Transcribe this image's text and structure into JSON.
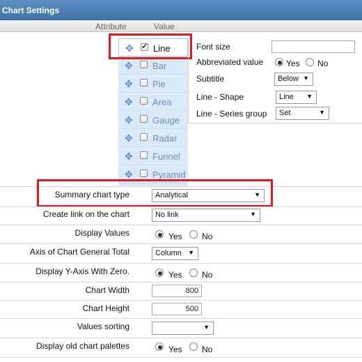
{
  "title": "Chart Settings",
  "columns": {
    "attribute": "Attribute",
    "value": "Value"
  },
  "chart_types": [
    {
      "label": "Line",
      "checked": true
    },
    {
      "label": "Bar",
      "checked": false
    },
    {
      "label": "Pie",
      "checked": false
    },
    {
      "label": "Area",
      "checked": false
    },
    {
      "label": "Gauge",
      "checked": false
    },
    {
      "label": "Radar",
      "checked": false
    },
    {
      "label": "Funnel",
      "checked": false
    },
    {
      "label": "Pyramid",
      "checked": false
    }
  ],
  "line_settings": {
    "font_size_label": "Font size",
    "font_size_value": "",
    "abbrev_label": "Abbreviated value",
    "yes": "Yes",
    "no": "No",
    "subtitle_label": "Subtitle",
    "subtitle_value": "Below",
    "shape_label": "Line - Shape",
    "shape_value": "Line",
    "series_label": "Line - Series group",
    "series_value": "Set"
  },
  "rows": {
    "summary": {
      "label": "Summary chart type",
      "value": "Analytical"
    },
    "link": {
      "label": "Create link on the chart",
      "value": "No link"
    },
    "display_values": {
      "label": "Display Values",
      "yes": "Yes",
      "no": "No"
    },
    "axis_total": {
      "label": "Axis of Chart General Total",
      "value": "Column"
    },
    "y_zero": {
      "label": "Display Y-Axis With Zero.",
      "yes": "Yes",
      "no": "No"
    },
    "width": {
      "label": "Chart Width",
      "value": "800"
    },
    "height": {
      "label": "Chart Height",
      "value": "500"
    },
    "sorting": {
      "label": "Values sorting",
      "value": ""
    },
    "old_palettes": {
      "label": "Display old chart palettes",
      "yes": "Yes",
      "no": "No"
    }
  }
}
